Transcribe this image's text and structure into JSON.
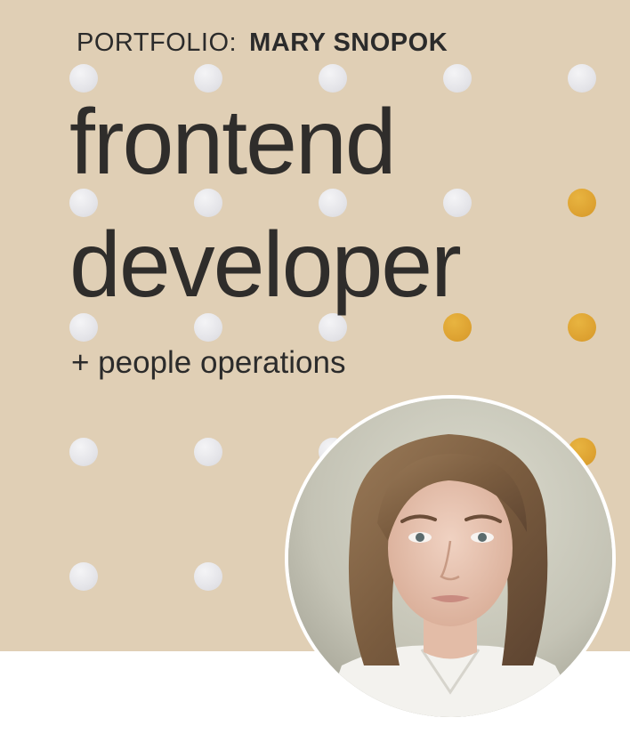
{
  "header": {
    "portfolio_label": "PORTFOLIO:",
    "owner_name": "MARY SNOPOK"
  },
  "hero": {
    "title_line1": "frontend",
    "title_line2": "developer",
    "subtitle": "+ people operations"
  },
  "colors": {
    "background": "#e0cfb5",
    "dot_grey": "#e6e6ea",
    "dot_gold": "#dea332",
    "text": "#2f2d2b"
  },
  "avatar": {
    "subject": "portrait photo of a woman with shoulder-length brown hair"
  }
}
